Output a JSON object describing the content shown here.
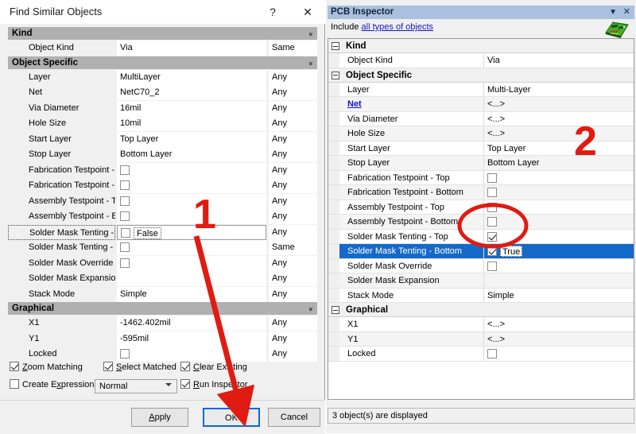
{
  "find_similar": {
    "title": "Find Similar Objects",
    "help_icon": "?",
    "close_icon": "✕",
    "sections": [
      {
        "name": "Kind",
        "rows": [
          {
            "label": "Object Kind",
            "value": "Via",
            "match": "Same",
            "type": "text"
          }
        ]
      },
      {
        "name": "Object Specific",
        "rows": [
          {
            "label": "Layer",
            "value": "MultiLayer",
            "match": "Any",
            "type": "text"
          },
          {
            "label": "Net",
            "value": "NetC70_2",
            "match": "Any",
            "type": "text"
          },
          {
            "label": "Via Diameter",
            "value": "16mil",
            "match": "Any",
            "type": "text"
          },
          {
            "label": "Hole Size",
            "value": "10mil",
            "match": "Any",
            "type": "text"
          },
          {
            "label": "Start Layer",
            "value": "Top Layer",
            "match": "Any",
            "type": "text"
          },
          {
            "label": "Stop Layer",
            "value": "Bottom Layer",
            "match": "Any",
            "type": "text"
          },
          {
            "label": "Fabrication Testpoint - Top",
            "value": "",
            "match": "Any",
            "type": "checkbox",
            "checked": false
          },
          {
            "label": "Fabrication Testpoint - Bottom",
            "value": "",
            "match": "Any",
            "type": "checkbox",
            "checked": false
          },
          {
            "label": "Assembly Testpoint - Top",
            "value": "",
            "match": "Any",
            "type": "checkbox",
            "checked": false
          },
          {
            "label": "Assembly Testpoint - Bottom",
            "value": "",
            "match": "Any",
            "type": "checkbox",
            "checked": false
          },
          {
            "label": "Solder Mask Tenting - Top",
            "value": "False",
            "match": "Any",
            "type": "checkbox-edit",
            "checked": false,
            "focused": true
          },
          {
            "label": "Solder Mask Tenting - Bottom",
            "value": "",
            "match": "Same",
            "type": "checkbox",
            "checked": false
          },
          {
            "label": "Solder Mask Override",
            "value": "",
            "match": "Any",
            "type": "checkbox",
            "checked": false
          },
          {
            "label": "Solder Mask Expansion",
            "value": "",
            "match": "Any",
            "type": "text"
          },
          {
            "label": "Stack Mode",
            "value": "Simple",
            "match": "Any",
            "type": "text"
          }
        ]
      },
      {
        "name": "Graphical",
        "rows": [
          {
            "label": "X1",
            "value": "-1462.402mil",
            "match": "Any",
            "type": "text"
          },
          {
            "label": "Y1",
            "value": "-595mil",
            "match": "Any",
            "type": "text"
          },
          {
            "label": "Locked",
            "value": "",
            "match": "Any",
            "type": "checkbox",
            "checked": false
          }
        ]
      }
    ],
    "options": [
      {
        "label": "Zoom Matching",
        "accel": "Z",
        "checked": true
      },
      {
        "label": "Select Matched",
        "accel": "S",
        "checked": true
      },
      {
        "label": "Clear Existing",
        "accel": "C",
        "checked": true
      },
      {
        "label": "Create Expression",
        "accel": "x",
        "checked": false
      },
      {
        "label": "Run Inspector",
        "accel": "R",
        "checked": true
      }
    ],
    "mode_select": {
      "value": "Normal"
    },
    "buttons": [
      {
        "label": "Apply",
        "accel": "A",
        "focused": false
      },
      {
        "label": "OK",
        "accel": "",
        "focused": true
      },
      {
        "label": "Cancel",
        "accel": "",
        "focused": false
      }
    ]
  },
  "pcb_inspector": {
    "title": "PCB Inspector",
    "collapse_icon": "▼",
    "close_icon": "✕",
    "include_label": "Include",
    "include_link": "all types of objects",
    "board_icon": "pcb-board-icon",
    "sections": [
      {
        "name": "Kind",
        "rows": [
          {
            "label": "Object Kind",
            "value": "Via",
            "type": "text"
          }
        ]
      },
      {
        "name": "Object Specific",
        "rows": [
          {
            "label": "Layer",
            "value": "Multi-Layer",
            "type": "text"
          },
          {
            "label": "Net",
            "value": "<...>",
            "type": "link"
          },
          {
            "label": "Via Diameter",
            "value": "<...>",
            "type": "text"
          },
          {
            "label": "Hole Size",
            "value": "<...>",
            "type": "text"
          },
          {
            "label": "Start Layer",
            "value": "Top Layer",
            "type": "text"
          },
          {
            "label": "Stop Layer",
            "value": "Bottom Layer",
            "type": "text"
          },
          {
            "label": "Fabrication Testpoint - Top",
            "value": "",
            "type": "checkbox",
            "checked": false
          },
          {
            "label": "Fabrication Testpoint - Bottom",
            "value": "",
            "type": "checkbox",
            "checked": false
          },
          {
            "label": "Assembly Testpoint - Top",
            "value": "",
            "type": "checkbox",
            "checked": false
          },
          {
            "label": "Assembly Testpoint - Bottom",
            "value": "",
            "type": "checkbox",
            "checked": false
          },
          {
            "label": "Solder Mask Tenting - Top",
            "value": "",
            "type": "checkbox",
            "checked": true
          },
          {
            "label": "Solder Mask Tenting - Bottom",
            "value": "True",
            "type": "checkbox-edit",
            "checked": true,
            "selected": true
          },
          {
            "label": "Solder Mask Override",
            "value": "",
            "type": "checkbox",
            "checked": false
          },
          {
            "label": "Solder Mask Expansion",
            "value": "",
            "type": "text"
          },
          {
            "label": "Stack Mode",
            "value": "Simple",
            "type": "text"
          }
        ]
      },
      {
        "name": "Graphical",
        "rows": [
          {
            "label": "X1",
            "value": "<...>",
            "type": "text"
          },
          {
            "label": "Y1",
            "value": "<...>",
            "type": "text"
          },
          {
            "label": "Locked",
            "value": "",
            "type": "checkbox",
            "checked": false
          }
        ]
      }
    ],
    "status": "3 object(s) are displayed"
  },
  "annotations": {
    "marker_one": "1",
    "marker_two": "2",
    "accent_color": "#e01b12"
  }
}
